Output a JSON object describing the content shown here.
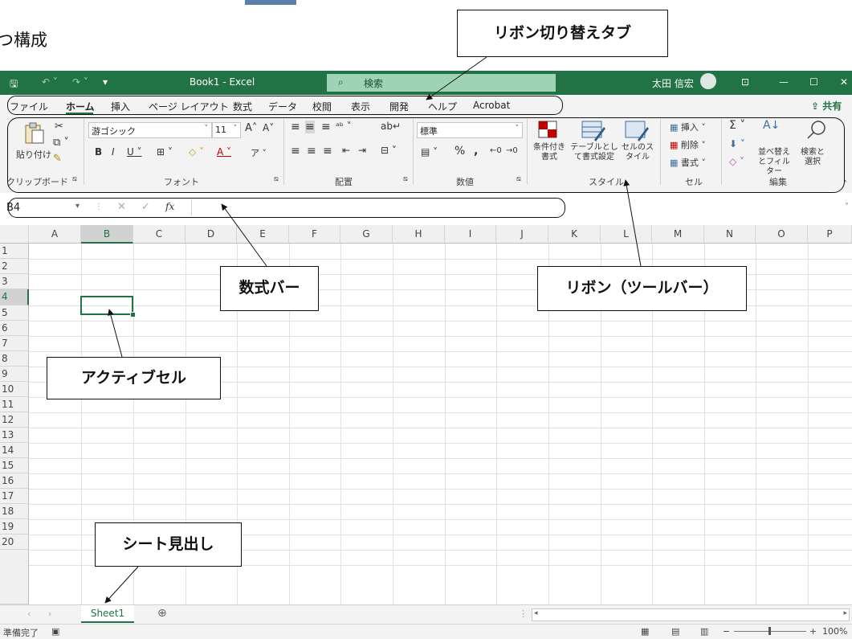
{
  "page_heading": "つ構成",
  "titlebar": {
    "filename": "Book1 - Excel",
    "search_label": "検索",
    "user_name": "太田 信宏"
  },
  "tabs": [
    "ファイル",
    "ホーム",
    "挿入",
    "ページ レイアウト",
    "数式",
    "データ",
    "校閲",
    "表示",
    "開発",
    "ヘルプ",
    "Acrobat"
  ],
  "active_tab": "ホーム",
  "share_label": "共有",
  "ribbon": {
    "clipboard": {
      "paste_label": "貼り付け",
      "group_label": "クリップボード"
    },
    "font": {
      "font_name": "游ゴシック",
      "font_size": "11",
      "group_label": "フォント"
    },
    "alignment": {
      "group_label": "配置"
    },
    "number": {
      "format": "標準",
      "group_label": "数値"
    },
    "styles": {
      "conditional_label": "条件付き書式",
      "table_label": "テーブルとして書式設定",
      "cell_style_label": "セルのスタイル",
      "group_label": "スタイル"
    },
    "cells": {
      "insert_label": "挿入",
      "delete_label": "削除",
      "format_label": "書式",
      "group_label": "セル"
    },
    "editing": {
      "sort_label": "並べ替えとフィルター",
      "find_label": "検索と選択",
      "group_label": "編集"
    }
  },
  "formula_bar": {
    "name_box": "B4",
    "fx": "fx",
    "value": ""
  },
  "grid": {
    "columns": [
      "A",
      "B",
      "C",
      "D",
      "E",
      "F",
      "G",
      "H",
      "I",
      "J",
      "K",
      "L",
      "M",
      "N",
      "O",
      "P"
    ],
    "rows": [
      "1",
      "2",
      "3",
      "4",
      "5",
      "6",
      "7",
      "8",
      "9",
      "10",
      "11",
      "12",
      "13",
      "14",
      "15",
      "16",
      "17",
      "18",
      "19",
      "20"
    ],
    "active_column": "B",
    "active_row": "4"
  },
  "sheet_tab": "Sheet1",
  "status": {
    "ready": "準備完了",
    "zoom": "100%"
  },
  "annotations": {
    "ribbon_tabs": "リボン切り替えタブ",
    "formula_bar": "数式バー",
    "ribbon": "リボン（ツールバー）",
    "active_cell": "アクティブセル",
    "sheet_tab": "シート見出し"
  },
  "colors": {
    "excel_green": "#217346",
    "search_box": "#9fd3b5",
    "ribbon_bg": "#f3f3f3",
    "gridline": "#e1e1e1"
  }
}
